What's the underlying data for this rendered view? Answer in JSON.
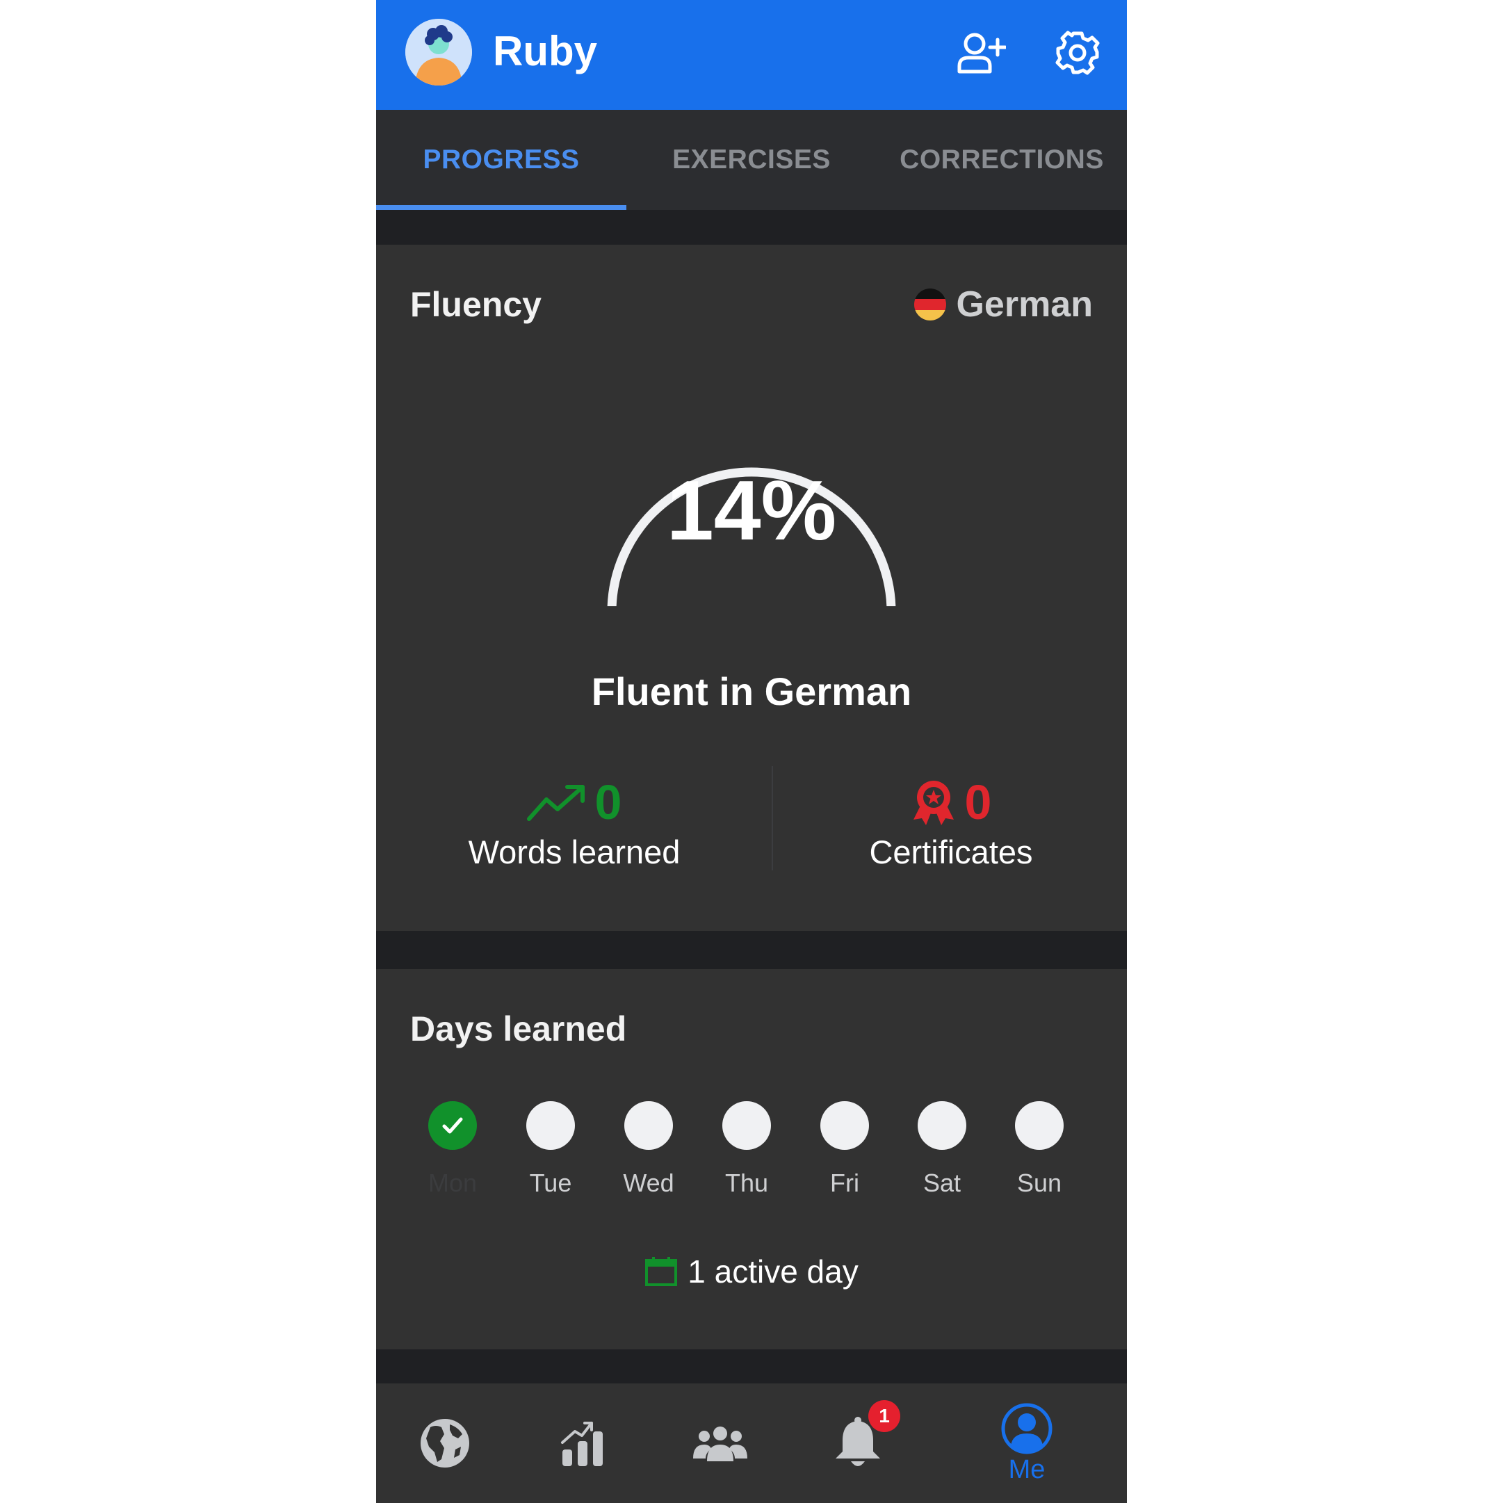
{
  "header": {
    "username": "Ruby",
    "add_friend_icon": "add-user-icon",
    "settings_icon": "gear-icon"
  },
  "tabs": [
    {
      "label": "PROGRESS",
      "active": true
    },
    {
      "label": "EXERCISES",
      "active": false
    },
    {
      "label": "CORRECTIONS",
      "active": false
    }
  ],
  "fluency": {
    "title": "Fluency",
    "language": "German",
    "percent_text": "14%",
    "percent_value": 14,
    "fluent_label": "Fluent in German",
    "words_count": "0",
    "words_label": "Words learned",
    "certificates_count": "0",
    "certificates_label": "Certificates"
  },
  "days_learned": {
    "title": "Days learned",
    "days": [
      {
        "label": "Mon",
        "done": true
      },
      {
        "label": "Tue",
        "done": false
      },
      {
        "label": "Wed",
        "done": false
      },
      {
        "label": "Thu",
        "done": false
      },
      {
        "label": "Fri",
        "done": false
      },
      {
        "label": "Sat",
        "done": false
      },
      {
        "label": "Sun",
        "done": false
      }
    ],
    "active_days_label": "1 active day"
  },
  "bottom_nav": {
    "items": [
      {
        "icon": "globe-icon"
      },
      {
        "icon": "bar-chart-icon"
      },
      {
        "icon": "community-icon"
      },
      {
        "icon": "bell-icon",
        "badge": "1"
      },
      {
        "icon": "profile-icon",
        "label": "Me",
        "active": true
      }
    ]
  },
  "colors": {
    "brand_blue": "#1870eb",
    "tab_active": "#4a8ef0",
    "success_green": "#11912b",
    "certificate_red": "#e0262d",
    "card_bg": "#323232"
  }
}
